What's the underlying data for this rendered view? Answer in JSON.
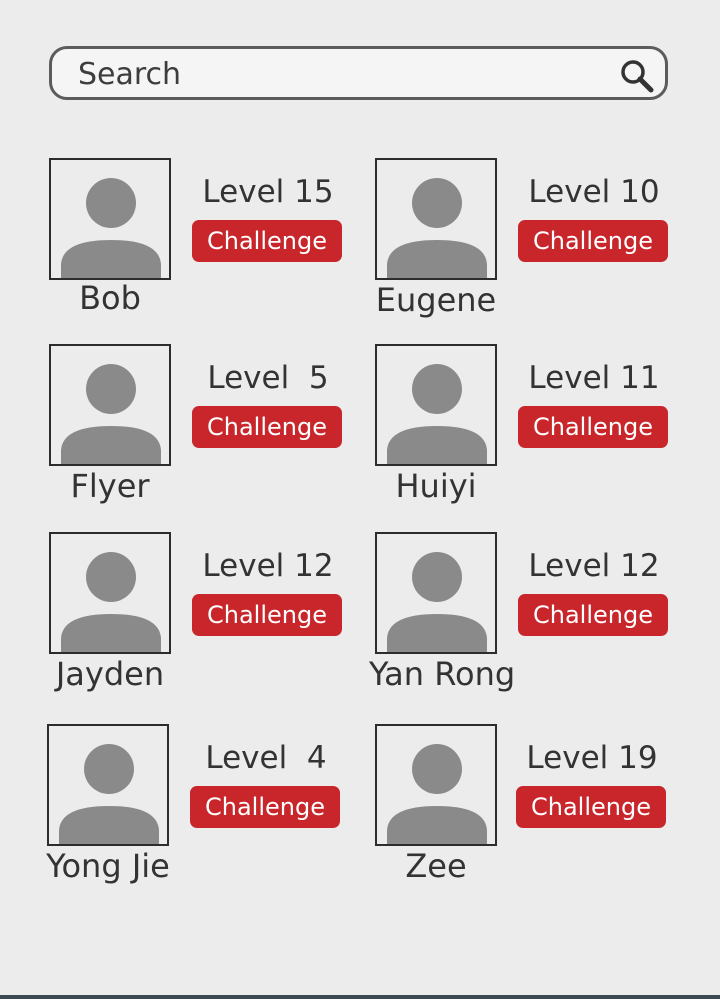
{
  "search": {
    "placeholder": "Search",
    "value": ""
  },
  "players": [
    {
      "name": "Bob",
      "level": "Level 15",
      "button": "Challenge"
    },
    {
      "name": "Eugene",
      "level": "Level 10",
      "button": "Challenge"
    },
    {
      "name": "Flyer",
      "level": "Level  5",
      "button": "Challenge"
    },
    {
      "name": "Huiyi",
      "level": "Level 11",
      "button": "Challenge"
    },
    {
      "name": "Jayden",
      "level": "Level 12",
      "button": "Challenge"
    },
    {
      "name": "Yan Rong",
      "level": "Level 12",
      "button": "Challenge"
    },
    {
      "name": "Yong Jie",
      "level": "Level  4",
      "button": "Challenge"
    },
    {
      "name": "Zee",
      "level": "Level 19",
      "button": "Challenge"
    }
  ],
  "theme": {
    "accent": "#c8262b",
    "background": "#ececec",
    "avatar_fill": "#8a8a8a"
  }
}
